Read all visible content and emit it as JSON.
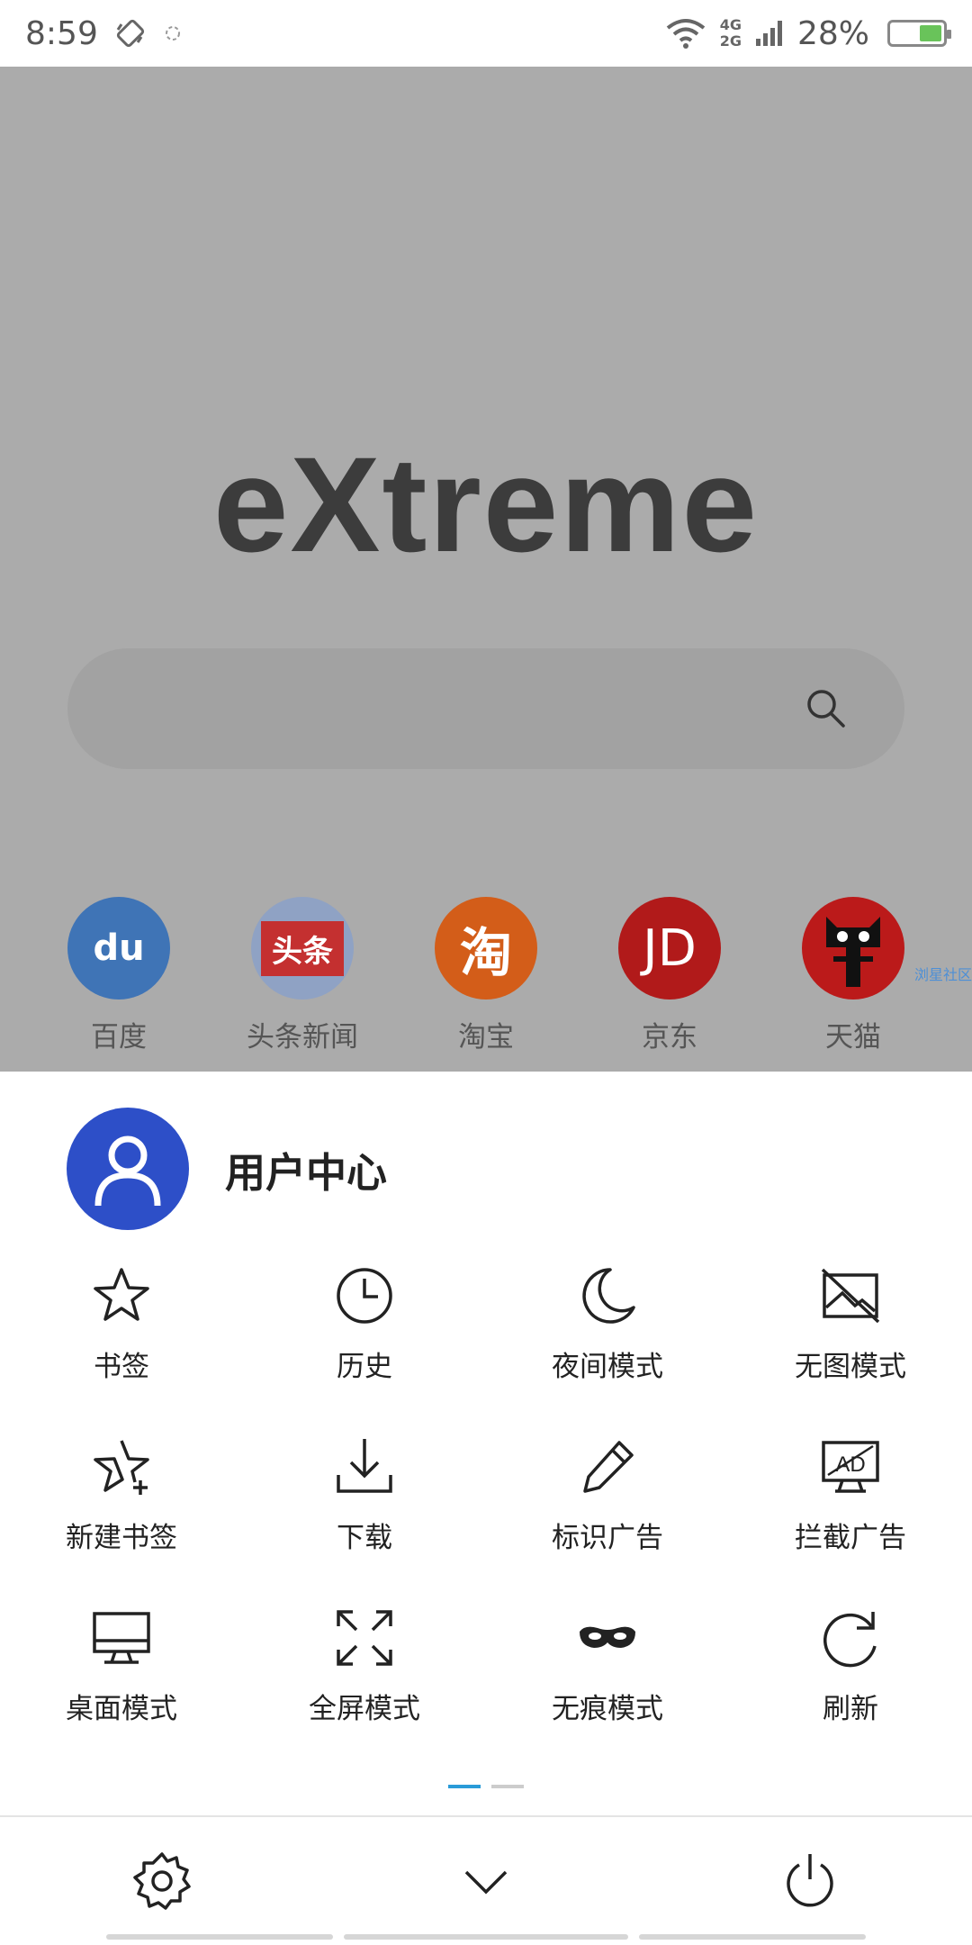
{
  "status_bar": {
    "time": "8:59",
    "net_top": "4G",
    "net_bottom": "2G",
    "battery": "28%",
    "icons": [
      "rotate-icon",
      "sync-icon",
      "wifi-icon",
      "signal-icon",
      "battery-icon"
    ]
  },
  "home": {
    "logo": "eXtreme",
    "search_icon": "search-icon",
    "shortcuts": [
      {
        "label": "百度",
        "icon_text": "du",
        "color": "#3f74b6"
      },
      {
        "label": "头条新闻",
        "icon_text": "头条",
        "color": "#c43030"
      },
      {
        "label": "淘宝",
        "icon_text": "淘",
        "color": "#d35d19"
      },
      {
        "label": "京东",
        "icon_text": "JD",
        "color": "#b11a1a"
      },
      {
        "label": "天猫",
        "icon_text": "",
        "color": "#bb1a1a"
      }
    ],
    "watermark": "浏星社区"
  },
  "menu": {
    "user_center": "用户中心",
    "items": [
      {
        "label": "书签",
        "icon": "star-icon"
      },
      {
        "label": "历史",
        "icon": "clock-icon"
      },
      {
        "label": "夜间模式",
        "icon": "moon-icon"
      },
      {
        "label": "无图模式",
        "icon": "no-image-icon"
      },
      {
        "label": "新建书签",
        "icon": "star-plus-icon"
      },
      {
        "label": "下载",
        "icon": "download-icon"
      },
      {
        "label": "标识广告",
        "icon": "pen-icon"
      },
      {
        "label": "拦截广告",
        "icon": "ad-block-icon"
      },
      {
        "label": "桌面模式",
        "icon": "desktop-icon"
      },
      {
        "label": "全屏模式",
        "icon": "fullscreen-icon"
      },
      {
        "label": "无痕模式",
        "icon": "mask-icon"
      },
      {
        "label": "刷新",
        "icon": "refresh-icon"
      }
    ],
    "page_indicator": {
      "pages": 2,
      "active": 1
    }
  },
  "bottom_bar": {
    "buttons": [
      "settings-icon",
      "chevron-down-icon",
      "power-icon"
    ]
  },
  "colors": {
    "accent": "#2a9bd8",
    "avatar": "#2d4fc8",
    "overlay": "#ababab"
  }
}
